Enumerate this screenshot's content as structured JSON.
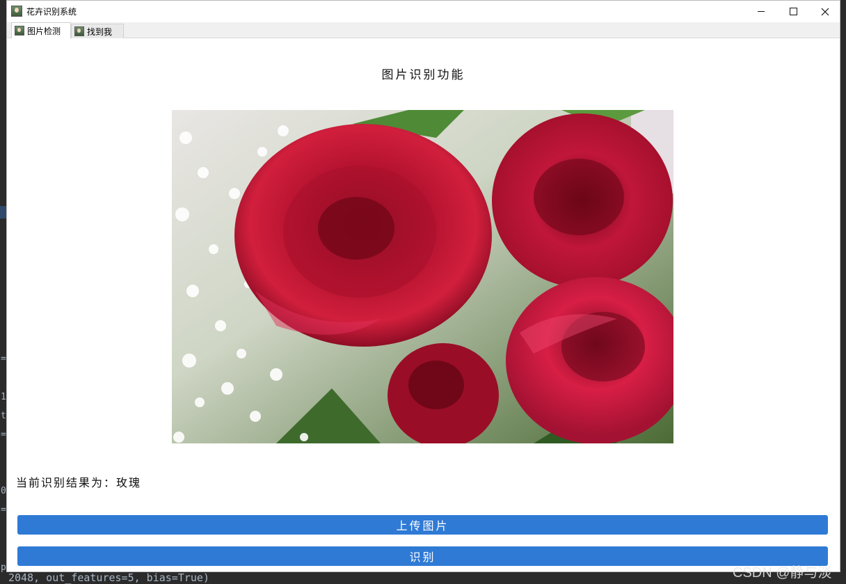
{
  "window": {
    "title": "花卉识别系统",
    "controls": {
      "minimize": "minimize",
      "maximize": "maximize",
      "close": "close"
    }
  },
  "tabs": [
    {
      "label": "图片检测",
      "active": true
    },
    {
      "label": "找到我",
      "active": false
    }
  ],
  "main": {
    "heading": "图片识别功能",
    "image_subject": "red roses with baby's breath",
    "result_text": "当前识别结果为：玫瑰",
    "upload_button": "上传图片",
    "identify_button": "识别"
  },
  "background": {
    "code_line": "p",
    "bottom_code": "2048, out_features=5, bias=True)",
    "left_chars": [
      "=",
      "1",
      "t",
      "=",
      "0",
      "="
    ]
  },
  "watermark": "CSDN @静与淡",
  "colors": {
    "button": "#2f7ad5",
    "window_bg": "#ffffff",
    "tab_bg": "#f0f0f0"
  }
}
